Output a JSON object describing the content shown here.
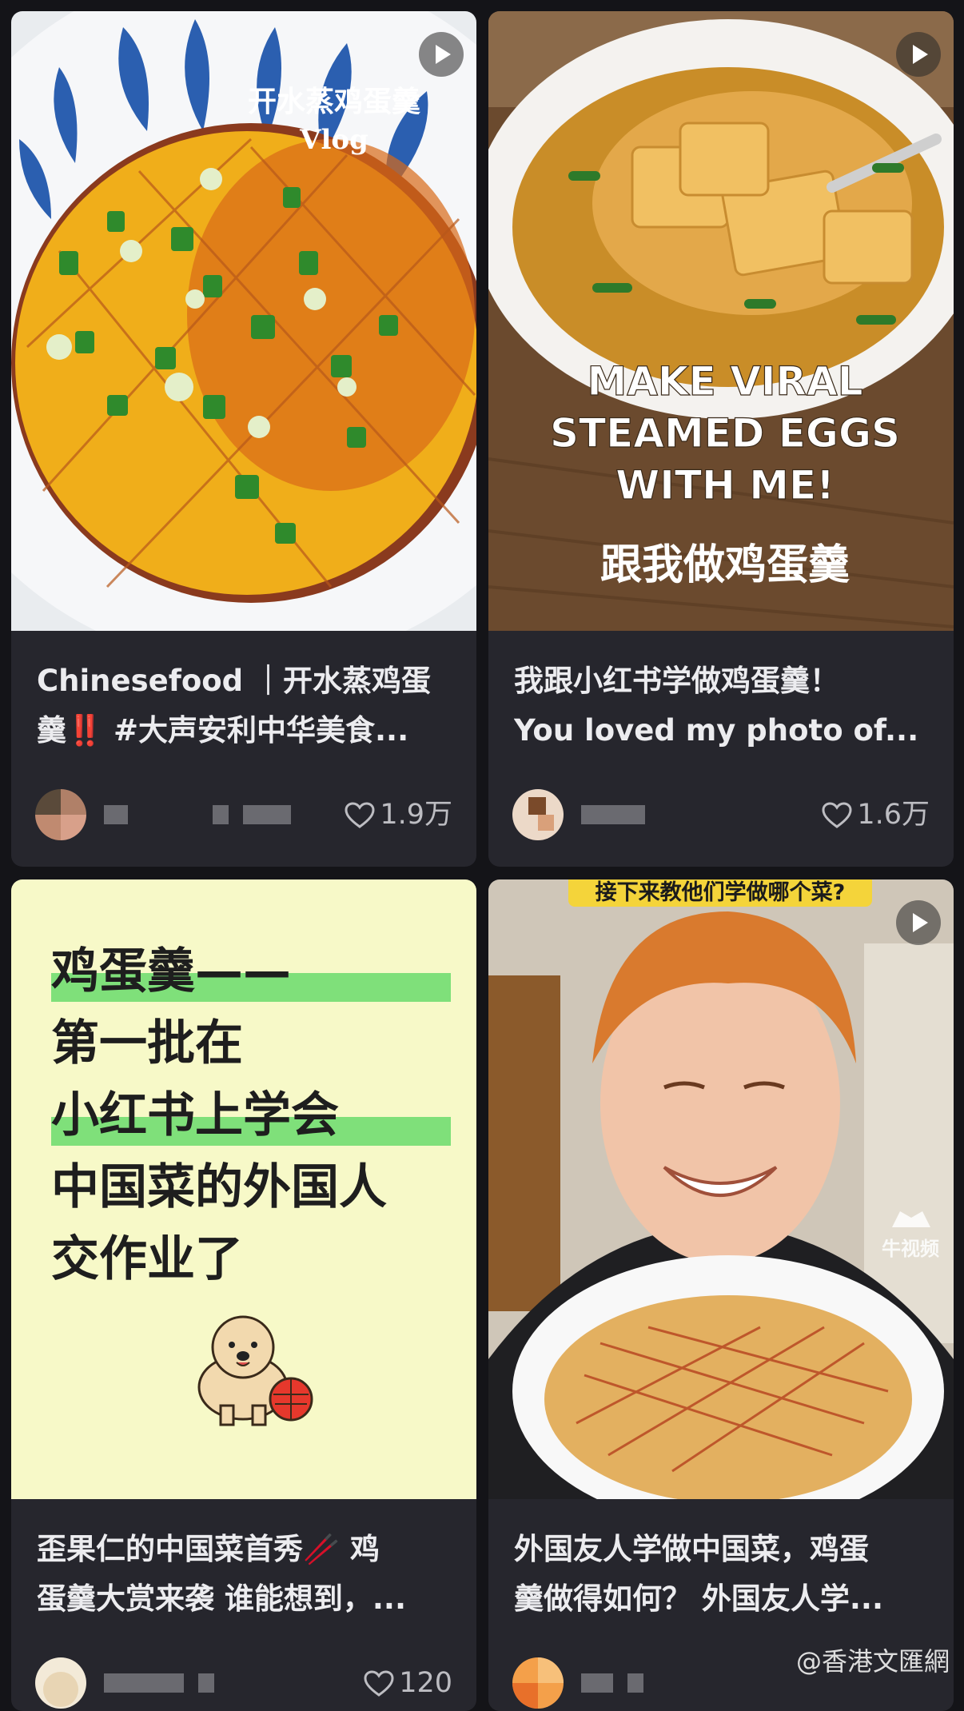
{
  "posts": [
    {
      "title_line1": "Chinesefood ｜开水蒸鸡蛋",
      "title_line2": "羹‼️ #大声安利中华美食...",
      "likes": "1.9万",
      "overlay_text": "开水蒸鸡蛋羹",
      "overlay_text2": "Vlog",
      "has_video": true,
      "like_icon": "heart-outline-icon"
    },
    {
      "title_line1": "我跟小红书学做鸡蛋羹！",
      "title_line2": "You loved my photo of...",
      "likes": "1.6万",
      "overlay_lines": [
        "MAKE VIRAL",
        "STEAMED EGGS",
        "WITH ME!"
      ],
      "overlay_cn": "跟我做鸡蛋羹",
      "has_video": true,
      "like_icon": "heart-outline-icon"
    },
    {
      "title_line1": "歪果仁的中国菜首秀🥢 鸡",
      "title_line2": "蛋羹大赏来袭 谁能想到，...",
      "likes": "120",
      "post_lines": [
        "鸡蛋羹——",
        "第一批在",
        "小红书上学会",
        "中国菜的外国人",
        "交作业了"
      ],
      "has_video": false,
      "like_icon": "heart-outline-icon"
    },
    {
      "title_line1": "外国友人学做中国菜，鸡蛋",
      "title_line2": "羹做得如何？ 外国友人学...",
      "banner": "接下来教他们学做哪个菜?",
      "logo_text": "牛视频",
      "has_video": true,
      "like_icon": "heart-outline-icon"
    }
  ],
  "watermark": "@香港文匯網",
  "colors": {
    "background": "#141418",
    "card": "#26262d",
    "title": "#ececef",
    "muted": "#bdbdc2"
  }
}
